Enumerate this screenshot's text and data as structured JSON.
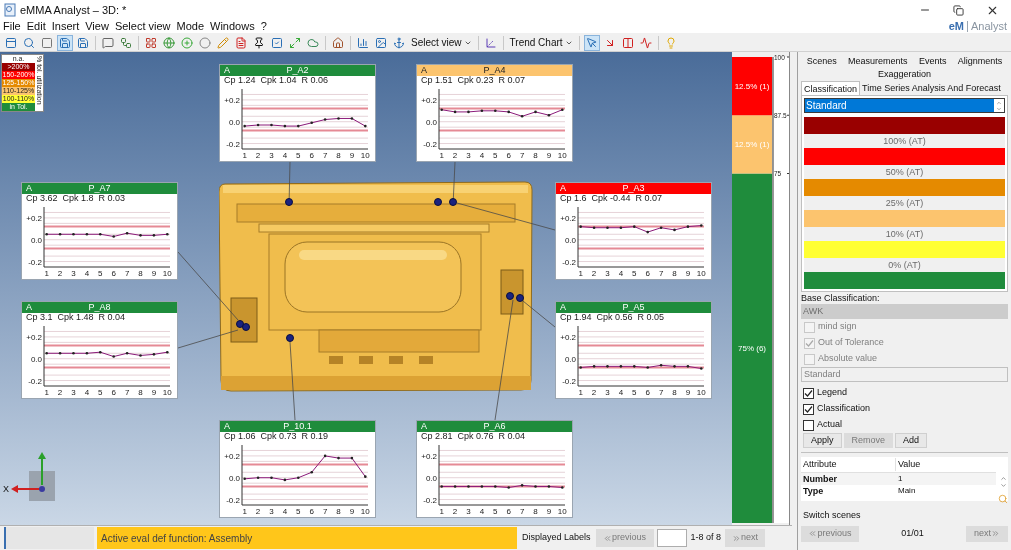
{
  "window": {
    "title": "eMMA Analyst – 3D: *"
  },
  "menu": [
    "File",
    "Edit",
    "Insert",
    "View",
    "Select view",
    "Mode",
    "Windows",
    "?"
  ],
  "brand": {
    "mark": "eM",
    "name": "Analyst"
  },
  "toolbar": [
    {
      "kind": "panel",
      "pressed": false
    },
    {
      "kind": "zoom",
      "pressed": false
    },
    {
      "kind": "block",
      "pressed": false
    },
    {
      "kind": "save3d",
      "pressed": true
    },
    {
      "kind": "save",
      "pressed": false
    },
    {
      "kind": "separator"
    },
    {
      "kind": "comment",
      "pressed": false
    },
    {
      "kind": "tree",
      "pressed": false
    },
    {
      "kind": "separator"
    },
    {
      "kind": "grid",
      "pressed": false
    },
    {
      "kind": "globe",
      "pressed": false
    },
    {
      "kind": "add",
      "pressed": false
    },
    {
      "kind": "dot",
      "pressed": false
    },
    {
      "kind": "edit",
      "pressed": false
    },
    {
      "kind": "pdf",
      "pressed": false
    },
    {
      "kind": "pin",
      "pressed": false
    },
    {
      "kind": "check",
      "pressed": false
    },
    {
      "kind": "expand",
      "pressed": false
    },
    {
      "kind": "cloud",
      "pressed": false
    },
    {
      "kind": "separator"
    },
    {
      "kind": "home",
      "pressed": false
    },
    {
      "kind": "separator"
    },
    {
      "kind": "bars",
      "pressed": false
    },
    {
      "kind": "image",
      "pressed": false
    },
    {
      "kind": "anchor",
      "pressed": false
    },
    {
      "kind": "dropdown",
      "label": "Select view"
    },
    {
      "kind": "separator"
    },
    {
      "kind": "axes",
      "pressed": false
    },
    {
      "kind": "separator"
    },
    {
      "kind": "dropdown",
      "label": "Trend Chart"
    },
    {
      "kind": "separator"
    },
    {
      "kind": "pointer",
      "pressed": true
    },
    {
      "kind": "arrow",
      "pressed": false
    },
    {
      "kind": "columns",
      "pressed": false
    },
    {
      "kind": "wave",
      "pressed": false
    },
    {
      "kind": "separator"
    },
    {
      "kind": "bulb",
      "pressed": false
    }
  ],
  "tolerance_legend": {
    "title": "% tol. utilization",
    "items": [
      {
        "label": "n.a.",
        "color": "#ffffff"
      },
      {
        "label": ">200%",
        "color": "#990000"
      },
      {
        "label": "150-200%",
        "color": "#ff0000"
      },
      {
        "label": "125-150%",
        "color": "#e58a00"
      },
      {
        "label": "110-125%",
        "color": "#fcc46e"
      },
      {
        "label": "100-110%",
        "color": "#ffff33"
      },
      {
        "label": "in Tol.",
        "color": "#1f8c3c"
      }
    ]
  },
  "trend_cards": [
    {
      "header_left": "A",
      "name": "P_A2",
      "color": "#1f8c3c",
      "stats": "Cp 1.24  Cpk 1.04  R 0.06",
      "chart_data": {
        "type": "line",
        "x": [
          1,
          2,
          3,
          4,
          5,
          6,
          7,
          8,
          9,
          10
        ],
        "series": [
          {
            "color": "#8b1a7a",
            "values": [
              -0.04,
              -0.03,
              -0.03,
              -0.04,
              -0.04,
              -0.01,
              0.02,
              0.03,
              0.03,
              -0.04
            ]
          }
        ],
        "xlim": [
          0.8,
          10.2
        ],
        "ylim": [
          -0.25,
          0.3
        ],
        "grid": true,
        "yticks": [
          {
            "value": 0.2,
            "label": "+0.2"
          },
          {
            "value": 0,
            "label": "0.0"
          },
          {
            "value": -0.2,
            "label": "-0.2"
          }
        ],
        "xticks": [
          1,
          2,
          3,
          4,
          5,
          6,
          7,
          8,
          9,
          10
        ]
      }
    },
    {
      "header_left": "A",
      "name": "P_A4",
      "color": "#fcc46e",
      "stats": "Cp 1.51  Cpk 0.23  R 0.07",
      "chart_data": {
        "type": "line",
        "x": [
          1,
          2,
          3,
          4,
          5,
          6,
          7,
          8,
          9,
          10
        ],
        "series": [
          {
            "color": "#8b1a7a",
            "values": [
              0.11,
              0.09,
              0.09,
              0.1,
              0.1,
              0.09,
              0.05,
              0.09,
              0.06,
              0.11
            ]
          }
        ],
        "xlim": [
          0.8,
          10.2
        ],
        "ylim": [
          -0.25,
          0.3
        ],
        "grid": true,
        "yticks": [
          {
            "value": 0.2,
            "label": "+0.2"
          },
          {
            "value": 0,
            "label": "0.0"
          },
          {
            "value": -0.2,
            "label": "-0.2"
          }
        ],
        "xticks": [
          1,
          2,
          3,
          4,
          5,
          6,
          7,
          8,
          9,
          10
        ]
      }
    },
    {
      "header_left": "A",
      "name": "P_A7",
      "color": "#1f8c3c",
      "stats": "Cp 3.62  Cpk 1.8  R 0.03",
      "chart_data": {
        "type": "line",
        "x": [
          1,
          2,
          3,
          4,
          5,
          6,
          7,
          8,
          9,
          10
        ],
        "series": [
          {
            "color": "#8b1a7a",
            "values": [
              0.05,
              0.05,
              0.05,
              0.05,
              0.05,
              0.03,
              0.06,
              0.04,
              0.04,
              0.05
            ]
          }
        ],
        "xlim": [
          0.8,
          10.2
        ],
        "ylim": [
          -0.25,
          0.3
        ],
        "grid": true,
        "yticks": [
          {
            "value": 0.2,
            "label": "+0.2"
          },
          {
            "value": 0,
            "label": "0.0"
          },
          {
            "value": -0.2,
            "label": "-0.2"
          }
        ],
        "xticks": [
          1,
          2,
          3,
          4,
          5,
          6,
          7,
          8,
          9,
          10
        ]
      }
    },
    {
      "header_left": "A",
      "name": "P_A3",
      "color": "#ff0000",
      "stats": "Cp 1.6  Cpk -0.44  R 0.07",
      "chart_data": {
        "type": "line",
        "x": [
          1,
          2,
          3,
          4,
          5,
          6,
          7,
          8,
          9,
          10
        ],
        "series": [
          {
            "color": "#8b1a7a",
            "values": [
              0.12,
              0.11,
              0.11,
              0.11,
              0.12,
              0.07,
              0.11,
              0.09,
              0.12,
              0.13
            ]
          }
        ],
        "xlim": [
          0.8,
          10.2
        ],
        "ylim": [
          -0.25,
          0.3
        ],
        "grid": true,
        "yticks": [
          {
            "value": 0.2,
            "label": "+0.2"
          },
          {
            "value": 0,
            "label": "0.0"
          },
          {
            "value": -0.2,
            "label": "-0.2"
          }
        ],
        "xticks": [
          1,
          2,
          3,
          4,
          5,
          6,
          7,
          8,
          9,
          10
        ]
      }
    },
    {
      "header_left": "A",
      "name": "P_A8",
      "color": "#1f8c3c",
      "stats": "Cp 3.1  Cpk 1.48  R 0.04",
      "chart_data": {
        "type": "line",
        "x": [
          1,
          2,
          3,
          4,
          5,
          6,
          7,
          8,
          9,
          10
        ],
        "series": [
          {
            "color": "#8b1a7a",
            "values": [
              0.05,
              0.05,
              0.05,
              0.05,
              0.06,
              0.02,
              0.05,
              0.03,
              0.04,
              0.06
            ]
          }
        ],
        "xlim": [
          0.8,
          10.2
        ],
        "ylim": [
          -0.25,
          0.3
        ],
        "grid": true,
        "yticks": [
          {
            "value": 0.2,
            "label": "+0.2"
          },
          {
            "value": 0,
            "label": "0.0"
          },
          {
            "value": -0.2,
            "label": "-0.2"
          }
        ],
        "xticks": [
          1,
          2,
          3,
          4,
          5,
          6,
          7,
          8,
          9,
          10
        ]
      }
    },
    {
      "header_left": "A",
      "name": "P_A5",
      "color": "#1f8c3c",
      "stats": "Cp 1.94  Cpk 0.56  R 0.05",
      "chart_data": {
        "type": "line",
        "x": [
          1,
          2,
          3,
          4,
          5,
          6,
          7,
          8,
          9,
          10
        ],
        "series": [
          {
            "color": "#8b1a7a",
            "values": [
              -0.08,
              -0.07,
              -0.07,
              -0.07,
              -0.07,
              -0.08,
              -0.06,
              -0.07,
              -0.07,
              -0.09
            ]
          }
        ],
        "xlim": [
          0.8,
          10.2
        ],
        "ylim": [
          -0.25,
          0.3
        ],
        "grid": true,
        "yticks": [
          {
            "value": 0.2,
            "label": "+0.2"
          },
          {
            "value": 0,
            "label": "0.0"
          },
          {
            "value": -0.2,
            "label": "-0.2"
          }
        ],
        "xticks": [
          1,
          2,
          3,
          4,
          5,
          6,
          7,
          8,
          9,
          10
        ]
      }
    },
    {
      "header_left": "A",
      "name": "P_10.1",
      "color": "#1f8c3c",
      "stats": "Cp 1.06  Cpk 0.73  R 0.19",
      "chart_data": {
        "type": "line",
        "x": [
          1,
          2,
          3,
          4,
          5,
          6,
          7,
          8,
          9,
          10
        ],
        "series": [
          {
            "color": "#8b1a7a",
            "values": [
              -0.01,
              0,
              0,
              -0.02,
              0,
              0.05,
              0.2,
              0.18,
              0.18,
              0.01
            ]
          }
        ],
        "xlim": [
          0.8,
          10.2
        ],
        "ylim": [
          -0.25,
          0.3
        ],
        "grid": true,
        "yticks": [
          {
            "value": 0.2,
            "label": "+0.2"
          },
          {
            "value": 0,
            "label": "0.0"
          },
          {
            "value": -0.2,
            "label": "-0.2"
          }
        ],
        "xticks": [
          1,
          2,
          3,
          4,
          5,
          6,
          7,
          8,
          9,
          10
        ]
      }
    },
    {
      "header_left": "A",
      "name": "P_A6",
      "color": "#1f8c3c",
      "stats": "Cp 2.81  Cpk 0.76  R 0.04",
      "chart_data": {
        "type": "line",
        "x": [
          1,
          2,
          3,
          4,
          5,
          6,
          7,
          8,
          9,
          10
        ],
        "series": [
          {
            "color": "#8b1a7a",
            "values": [
              -0.08,
              -0.08,
              -0.08,
              -0.08,
              -0.08,
              -0.09,
              -0.07,
              -0.08,
              -0.08,
              -0.09
            ]
          }
        ],
        "xlim": [
          0.8,
          10.2
        ],
        "ylim": [
          -0.25,
          0.3
        ],
        "grid": true,
        "yticks": [
          {
            "value": 0.2,
            "label": "+0.2"
          },
          {
            "value": 0,
            "label": "0.0"
          },
          {
            "value": -0.2,
            "label": "-0.2"
          }
        ],
        "xticks": [
          1,
          2,
          3,
          4,
          5,
          6,
          7,
          8,
          9,
          10
        ]
      }
    }
  ],
  "axis_triad": {
    "x_label": "X"
  },
  "distribution_bar": {
    "chart_data": {
      "type": "bar",
      "stacked": true,
      "ylim": [
        0,
        100
      ],
      "yticks": [
        100,
        87.5,
        75
      ],
      "series": [
        {
          "color": "#1f8c3c",
          "values": [
            75
          ]
        },
        {
          "color": "#fcc46e",
          "values": [
            12.5
          ]
        },
        {
          "color": "#ff0000",
          "values": [
            12.5
          ]
        }
      ],
      "value_labels": [
        "75% (6)",
        "12.5% (1)",
        "12.5% (1)"
      ]
    }
  },
  "status_bar": {
    "eval_function": "Active eval def function: Assembly",
    "displayed_labels": "Displayed Labels",
    "previous": {
      "label": "previous",
      "disabled": true
    },
    "range": "1-8 of 8",
    "next": {
      "label": "next",
      "disabled": true
    }
  },
  "panel": {
    "tabs_top": [
      {
        "label": "Scenes",
        "selected": false
      },
      {
        "label": "Measurements",
        "selected": false
      },
      {
        "label": "Events",
        "selected": false
      },
      {
        "label": "Alignments",
        "selected": false
      },
      {
        "label": "Exaggeration",
        "selected": false
      }
    ],
    "tabs_sub": [
      {
        "label": "Classification",
        "selected": true
      },
      {
        "label": "Time Series Analysis And Forecast",
        "selected": false
      }
    ],
    "scheme_select": {
      "value": "Standard"
    },
    "bands": [
      {
        "color": "#990000",
        "threshold": "100% (AT)"
      },
      {
        "color": "#ff0000",
        "threshold": "50% (AT)"
      },
      {
        "color": "#e58a00",
        "threshold": "25% (AT)"
      },
      {
        "color": "#fcc46e",
        "threshold": "10% (AT)"
      },
      {
        "color": "#ffff33",
        "threshold": "0% (AT)"
      },
      {
        "color": "#1f8c3c"
      }
    ],
    "base_classification": {
      "label": "Base Classification:",
      "select": {
        "value": "AWK",
        "disabled": true
      },
      "options": [
        {
          "label": "mind sign",
          "checked": false,
          "disabled": true
        },
        {
          "label": "Out of Tolerance",
          "checked": true,
          "disabled": true
        },
        {
          "label": "Absolute value",
          "checked": false,
          "disabled": true
        }
      ],
      "field": {
        "value": "Standard",
        "disabled": true
      }
    },
    "display_options": [
      {
        "label": "Legend",
        "checked": true
      },
      {
        "label": "Classification",
        "checked": true
      },
      {
        "label": "Actual",
        "checked": false
      }
    ],
    "buttons": [
      {
        "label": "Apply",
        "disabled": false
      },
      {
        "label": "Remove",
        "disabled": true
      },
      {
        "label": "Add",
        "disabled": false
      }
    ],
    "attributes": {
      "columns": [
        "Attribute",
        "Value"
      ],
      "rows": [
        [
          "Number",
          "1"
        ],
        [
          "Type",
          "Main"
        ]
      ]
    },
    "switch_scenes": {
      "title": "Switch scenes",
      "previous": {
        "label": "previous",
        "disabled": true
      },
      "counter": "01/01",
      "next": {
        "label": "next",
        "disabled": true
      }
    }
  }
}
